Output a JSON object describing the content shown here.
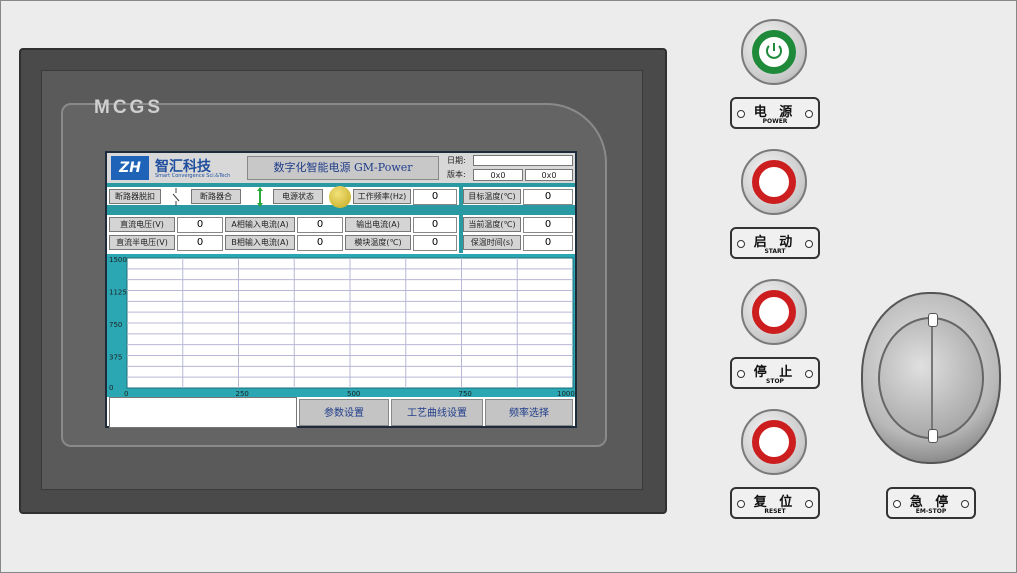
{
  "hmi": {
    "brand_label": "MCGS",
    "logo_text": "ZH",
    "company_name": "智汇科技",
    "company_sub": "Smart Convergence Sci.&Tech",
    "system_title": "数字化智能电源 GM-Power",
    "date_label": "日期:",
    "version_label": "版本:",
    "version_values": [
      "0x0",
      "0x0"
    ],
    "row1": {
      "breaker_off": "断路器脱扣",
      "breaker_on": "断路器合",
      "power_status": "电源状态",
      "work_freq_label": "工作频率(Hz)",
      "work_freq_value": "0",
      "target_temp_label": "目标温度(℃)",
      "target_temp_value": "0"
    },
    "measurements": [
      {
        "label": "直流电压(V)",
        "value": "0"
      },
      {
        "label": "A相输入电流(A)",
        "value": "0"
      },
      {
        "label": "输出电流(A)",
        "value": "0"
      },
      {
        "label": "当前温度(℃)",
        "value": "0"
      },
      {
        "label": "直流半电压(V)",
        "value": "0"
      },
      {
        "label": "B相输入电流(A)",
        "value": "0"
      },
      {
        "label": "模块温度(℃)",
        "value": "0"
      },
      {
        "label": "保温时间(s)",
        "value": "0"
      }
    ],
    "chart": {
      "y_ticks": [
        "1500",
        "1125",
        "750",
        "375",
        "0"
      ],
      "x_ticks": [
        "0",
        "250",
        "500",
        "750",
        "1000"
      ]
    },
    "nav": {
      "params": "参数设置",
      "curve": "工艺曲线设置",
      "freq": "频率选择"
    }
  },
  "panel": {
    "power": {
      "cn": "电 源",
      "en": "POWER",
      "color": "#1f8a3a"
    },
    "start": {
      "cn": "启 动",
      "en": "START",
      "color": "#cc1e1e"
    },
    "stop": {
      "cn": "停 止",
      "en": "STOP",
      "color": "#cc1e1e"
    },
    "reset": {
      "cn": "复 位",
      "en": "RESET",
      "color": "#cc1e1e"
    },
    "estop": {
      "cn": "急 停",
      "en": "EM-STOP"
    }
  }
}
